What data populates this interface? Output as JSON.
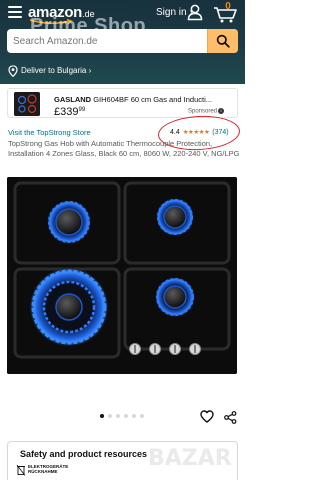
{
  "header": {
    "logo_word": "amazon",
    "logo_tld": ".de",
    "signin_label": "Sign in ›",
    "cart_count": "0",
    "watermark": "Prime Shop",
    "search": {
      "placeholder": "Search Amazon.de",
      "value": ""
    },
    "deliver_label": "Deliver to Bulgaria ›"
  },
  "sponsored_ad": {
    "brand": "GASLAND",
    "title": "GIH604BF 60 cm Gas and Inducti...",
    "price_whole": "£339",
    "price_fraction": "99",
    "sponsored_label": "Sponsored",
    "info_icon": "i"
  },
  "product": {
    "store_link": "Visit the TopStrong Store",
    "rating_value": "4.4",
    "stars_glyphs": "★★★★★",
    "rating_count": "(374)",
    "description": "TopStrong Gas Hob with Automatic Thermocouple Protection, Installation 4 Zones Glass, Black 60 cm, 8060 W, 220-240 V, NG/LPG"
  },
  "gallery": {
    "total_images": 6,
    "active_index": 0
  },
  "safety": {
    "title": "Safety and product resources",
    "badge_line1": "ELEKTROGERÄTE",
    "badge_line2": "RÜCKNAHME"
  },
  "overlay_watermark": "BAZAR",
  "colors": {
    "accent_orange": "#febd69",
    "link_teal": "#007185",
    "star_orange": "#de7921",
    "annotation_red": "#d9242c"
  }
}
